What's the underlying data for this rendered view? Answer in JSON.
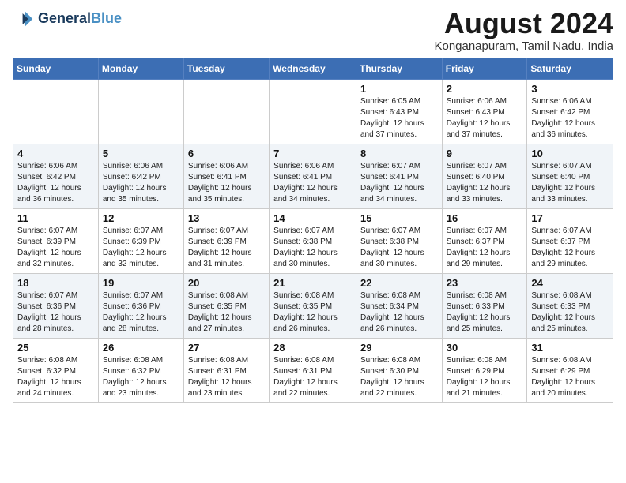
{
  "header": {
    "logo_line1": "General",
    "logo_line2": "Blue",
    "month_title": "August 2024",
    "subtitle": "Konganapuram, Tamil Nadu, India"
  },
  "weekdays": [
    "Sunday",
    "Monday",
    "Tuesday",
    "Wednesday",
    "Thursday",
    "Friday",
    "Saturday"
  ],
  "weeks": [
    [
      {
        "day": "",
        "info": ""
      },
      {
        "day": "",
        "info": ""
      },
      {
        "day": "",
        "info": ""
      },
      {
        "day": "",
        "info": ""
      },
      {
        "day": "1",
        "info": "Sunrise: 6:05 AM\nSunset: 6:43 PM\nDaylight: 12 hours\nand 37 minutes."
      },
      {
        "day": "2",
        "info": "Sunrise: 6:06 AM\nSunset: 6:43 PM\nDaylight: 12 hours\nand 37 minutes."
      },
      {
        "day": "3",
        "info": "Sunrise: 6:06 AM\nSunset: 6:42 PM\nDaylight: 12 hours\nand 36 minutes."
      }
    ],
    [
      {
        "day": "4",
        "info": "Sunrise: 6:06 AM\nSunset: 6:42 PM\nDaylight: 12 hours\nand 36 minutes."
      },
      {
        "day": "5",
        "info": "Sunrise: 6:06 AM\nSunset: 6:42 PM\nDaylight: 12 hours\nand 35 minutes."
      },
      {
        "day": "6",
        "info": "Sunrise: 6:06 AM\nSunset: 6:41 PM\nDaylight: 12 hours\nand 35 minutes."
      },
      {
        "day": "7",
        "info": "Sunrise: 6:06 AM\nSunset: 6:41 PM\nDaylight: 12 hours\nand 34 minutes."
      },
      {
        "day": "8",
        "info": "Sunrise: 6:07 AM\nSunset: 6:41 PM\nDaylight: 12 hours\nand 34 minutes."
      },
      {
        "day": "9",
        "info": "Sunrise: 6:07 AM\nSunset: 6:40 PM\nDaylight: 12 hours\nand 33 minutes."
      },
      {
        "day": "10",
        "info": "Sunrise: 6:07 AM\nSunset: 6:40 PM\nDaylight: 12 hours\nand 33 minutes."
      }
    ],
    [
      {
        "day": "11",
        "info": "Sunrise: 6:07 AM\nSunset: 6:39 PM\nDaylight: 12 hours\nand 32 minutes."
      },
      {
        "day": "12",
        "info": "Sunrise: 6:07 AM\nSunset: 6:39 PM\nDaylight: 12 hours\nand 32 minutes."
      },
      {
        "day": "13",
        "info": "Sunrise: 6:07 AM\nSunset: 6:39 PM\nDaylight: 12 hours\nand 31 minutes."
      },
      {
        "day": "14",
        "info": "Sunrise: 6:07 AM\nSunset: 6:38 PM\nDaylight: 12 hours\nand 30 minutes."
      },
      {
        "day": "15",
        "info": "Sunrise: 6:07 AM\nSunset: 6:38 PM\nDaylight: 12 hours\nand 30 minutes."
      },
      {
        "day": "16",
        "info": "Sunrise: 6:07 AM\nSunset: 6:37 PM\nDaylight: 12 hours\nand 29 minutes."
      },
      {
        "day": "17",
        "info": "Sunrise: 6:07 AM\nSunset: 6:37 PM\nDaylight: 12 hours\nand 29 minutes."
      }
    ],
    [
      {
        "day": "18",
        "info": "Sunrise: 6:07 AM\nSunset: 6:36 PM\nDaylight: 12 hours\nand 28 minutes."
      },
      {
        "day": "19",
        "info": "Sunrise: 6:07 AM\nSunset: 6:36 PM\nDaylight: 12 hours\nand 28 minutes."
      },
      {
        "day": "20",
        "info": "Sunrise: 6:08 AM\nSunset: 6:35 PM\nDaylight: 12 hours\nand 27 minutes."
      },
      {
        "day": "21",
        "info": "Sunrise: 6:08 AM\nSunset: 6:35 PM\nDaylight: 12 hours\nand 26 minutes."
      },
      {
        "day": "22",
        "info": "Sunrise: 6:08 AM\nSunset: 6:34 PM\nDaylight: 12 hours\nand 26 minutes."
      },
      {
        "day": "23",
        "info": "Sunrise: 6:08 AM\nSunset: 6:33 PM\nDaylight: 12 hours\nand 25 minutes."
      },
      {
        "day": "24",
        "info": "Sunrise: 6:08 AM\nSunset: 6:33 PM\nDaylight: 12 hours\nand 25 minutes."
      }
    ],
    [
      {
        "day": "25",
        "info": "Sunrise: 6:08 AM\nSunset: 6:32 PM\nDaylight: 12 hours\nand 24 minutes."
      },
      {
        "day": "26",
        "info": "Sunrise: 6:08 AM\nSunset: 6:32 PM\nDaylight: 12 hours\nand 23 minutes."
      },
      {
        "day": "27",
        "info": "Sunrise: 6:08 AM\nSunset: 6:31 PM\nDaylight: 12 hours\nand 23 minutes."
      },
      {
        "day": "28",
        "info": "Sunrise: 6:08 AM\nSunset: 6:31 PM\nDaylight: 12 hours\nand 22 minutes."
      },
      {
        "day": "29",
        "info": "Sunrise: 6:08 AM\nSunset: 6:30 PM\nDaylight: 12 hours\nand 22 minutes."
      },
      {
        "day": "30",
        "info": "Sunrise: 6:08 AM\nSunset: 6:29 PM\nDaylight: 12 hours\nand 21 minutes."
      },
      {
        "day": "31",
        "info": "Sunrise: 6:08 AM\nSunset: 6:29 PM\nDaylight: 12 hours\nand 20 minutes."
      }
    ]
  ]
}
